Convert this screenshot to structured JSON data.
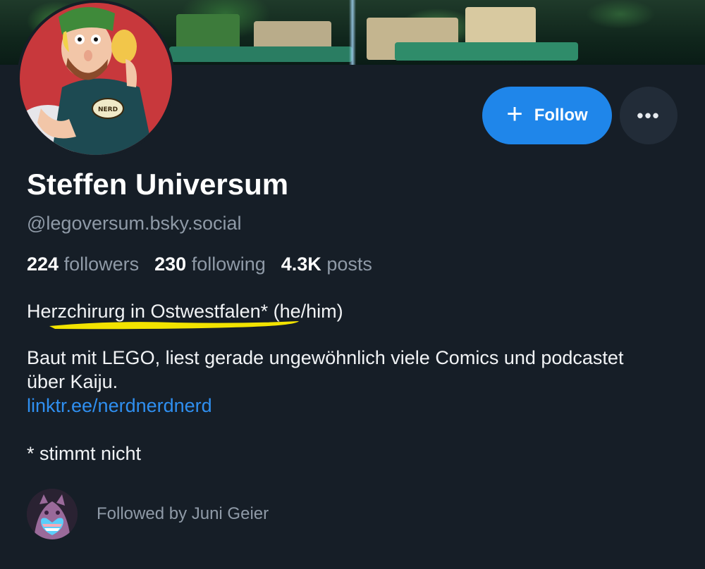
{
  "profile": {
    "display_name": "Steffen Universum",
    "handle": "@legoversum.bsky.social",
    "stats": {
      "followers_count": "224",
      "followers_label": "followers",
      "following_count": "230",
      "following_label": "following",
      "posts_count": "4.3K",
      "posts_label": "posts"
    },
    "bio": {
      "line1": "Herzchirurg in Ostwestfalen* (he/him)",
      "line2": "Baut mit LEGO, liest gerade ungewöhnlich viele Comics und podcastet über Kaiju.",
      "link": "linktr.ee/nerdnerdnerd",
      "line3": "* stimmt nicht"
    },
    "followed_by": "Followed by Juni Geier",
    "avatar_shirt_text": "NERD"
  },
  "actions": {
    "follow_label": "Follow",
    "follow_icon": "plus-icon",
    "more_label": "•••",
    "more_icon": "ellipsis-icon"
  },
  "colors": {
    "background": "#161e27",
    "accent": "#1f86ea",
    "link": "#2f8ff0",
    "muted": "#8f9aa7",
    "highlight": "#f2e300"
  }
}
